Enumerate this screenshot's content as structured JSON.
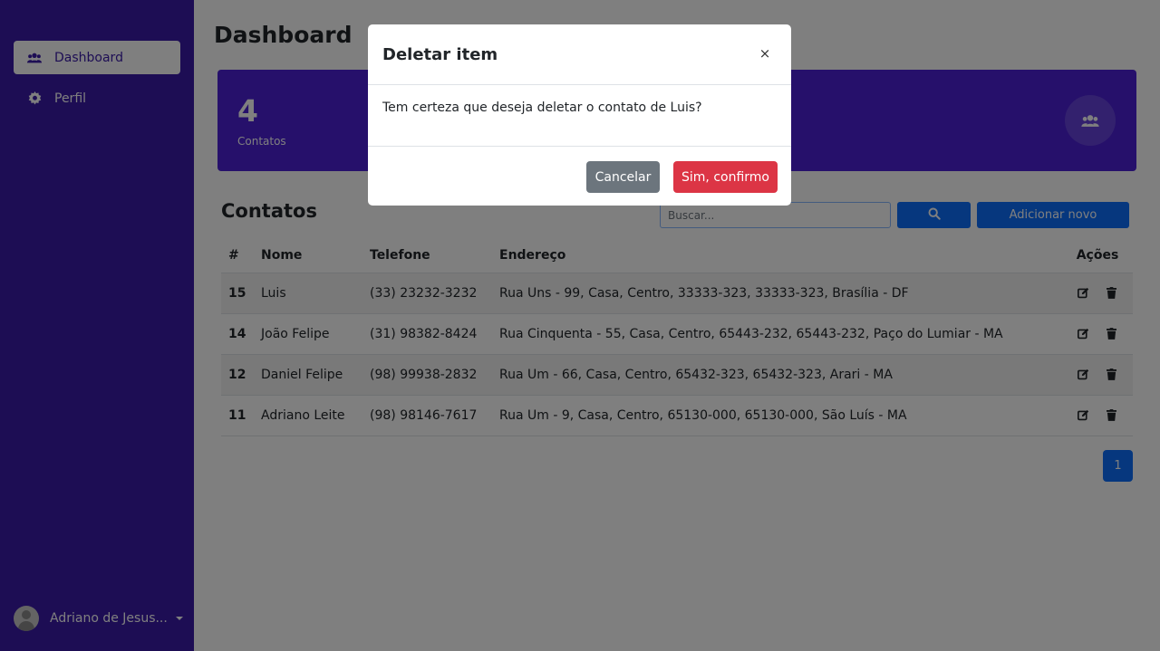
{
  "sidebar": {
    "items": [
      {
        "label": "Dashboard",
        "icon": "users-icon",
        "active": true
      },
      {
        "label": "Perfil",
        "icon": "gear-icon",
        "active": false
      }
    ],
    "user": {
      "name": "Adriano de Jesus..."
    }
  },
  "main": {
    "title": "Dashboard",
    "stat": {
      "value": "4",
      "label": "Contatos",
      "icon": "users-icon"
    },
    "contacts": {
      "title": "Contatos",
      "search_placeholder": "Buscar...",
      "add_label": "Adicionar novo",
      "columns": [
        "#",
        "Nome",
        "Telefone",
        "Endereço",
        "Ações"
      ],
      "rows": [
        {
          "id": "15",
          "name": "Luis",
          "phone": "(33) 23232-3232",
          "address": "Rua Uns - 99, Casa, Centro, 33333-323, 33333-323, Brasília - DF"
        },
        {
          "id": "14",
          "name": "João Felipe",
          "phone": "(31) 98382-8424",
          "address": "Rua Cinquenta - 55, Casa, Centro, 65443-232, 65443-232, Paço do Lumiar - MA"
        },
        {
          "id": "12",
          "name": "Daniel Felipe",
          "phone": "(98) 99938-2832",
          "address": "Rua Um - 66, Casa, Centro, 65432-323, 65432-323, Arari - MA"
        },
        {
          "id": "11",
          "name": "Adriano Leite",
          "phone": "(98) 98146-7617",
          "address": "Rua Um - 9, Casa, Centro, 65130-000, 65130-000, São Luís - MA"
        }
      ],
      "page": "1"
    }
  },
  "modal": {
    "title": "Deletar item",
    "close": "×",
    "body": "Tem certeza que deseja deletar o contato de Luis?",
    "cancel_label": "Cancelar",
    "confirm_label": "Sim, confirmo"
  },
  "colors": {
    "sidebar": "#3a1aa8",
    "stat_card": "#4c21d6",
    "primary": "#0d6efd",
    "danger": "#dc3545",
    "secondary": "#6c757d"
  }
}
